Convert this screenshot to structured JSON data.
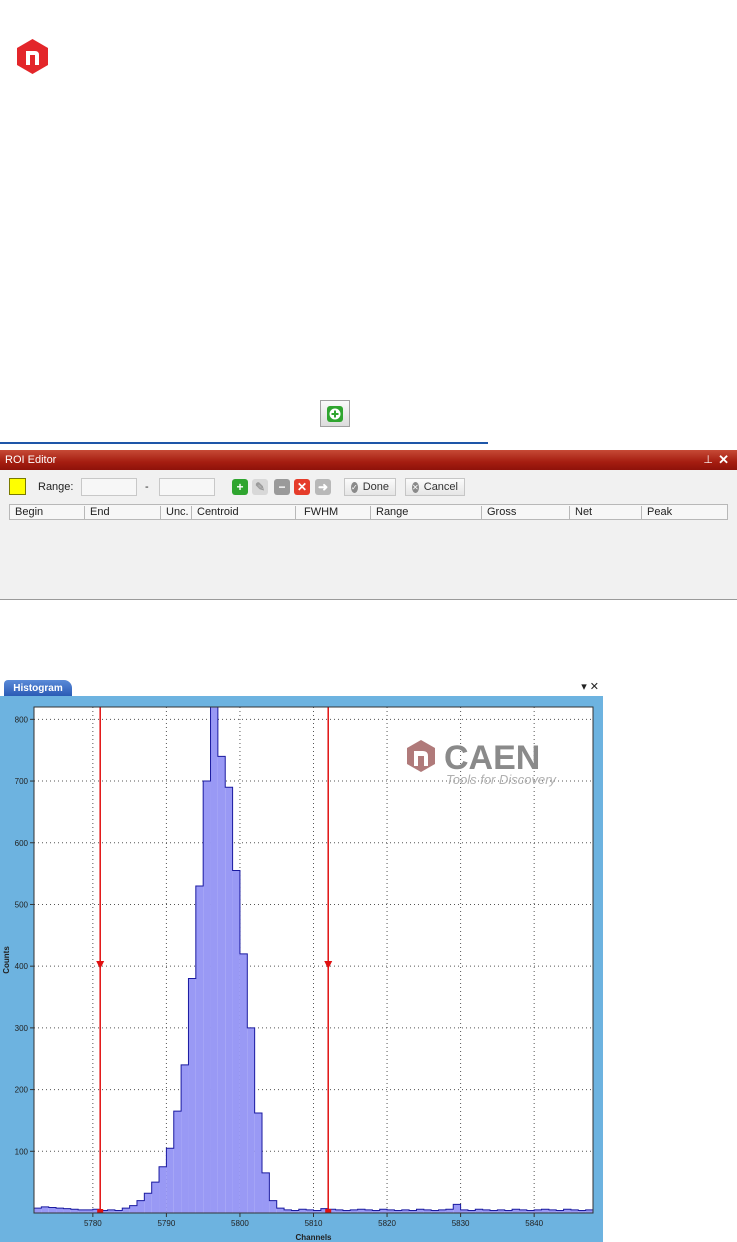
{
  "roi_editor": {
    "title": "ROI Editor",
    "pin_icon": "pin-icon",
    "close_icon": "close-icon",
    "range_label": "Range:",
    "range_from_value": "",
    "range_to_value": "",
    "range_separator": "-",
    "done_label": "Done",
    "cancel_label": "Cancel",
    "swatch_color": "#ffff00",
    "columns": [
      "Begin",
      "End",
      "Unc.",
      "Centroid",
      "FWHM",
      "Range",
      "Gross",
      "Net",
      "Peak"
    ]
  },
  "histogram": {
    "tab_label": "Histogram",
    "controls": "▾ ✕",
    "logo_text": "CAEN",
    "logo_tagline": "Tools for Discovery"
  },
  "chart_data": {
    "type": "bar",
    "xlabel": "Channels",
    "ylabel": "Counts",
    "xlim": [
      5772,
      5848
    ],
    "ylim": [
      0,
      820
    ],
    "grid": true,
    "x_ticks": [
      5780,
      5790,
      5800,
      5810,
      5820,
      5830,
      5840
    ],
    "y_ticks": [
      100,
      200,
      300,
      400,
      500,
      600,
      700,
      800
    ],
    "fill_color": "#9999f5",
    "edge_color": "#1a1aa0",
    "roi_markers": [
      5781,
      5812
    ],
    "roi_color": "#e01010",
    "bins_start": 5772,
    "values": [
      8,
      10,
      9,
      8,
      7,
      6,
      5,
      5,
      6,
      4,
      5,
      4,
      8,
      12,
      20,
      32,
      50,
      75,
      105,
      165,
      240,
      380,
      530,
      700,
      820,
      740,
      690,
      555,
      420,
      300,
      162,
      65,
      20,
      8,
      5,
      4,
      6,
      5,
      4,
      7,
      6,
      5,
      4,
      5,
      6,
      5,
      4,
      6,
      5,
      4,
      5,
      4,
      6,
      5,
      4,
      5,
      6,
      14,
      5,
      4,
      6,
      5,
      4,
      5,
      4,
      6,
      5,
      4,
      5,
      6,
      5,
      4,
      6,
      5,
      4,
      5
    ]
  }
}
